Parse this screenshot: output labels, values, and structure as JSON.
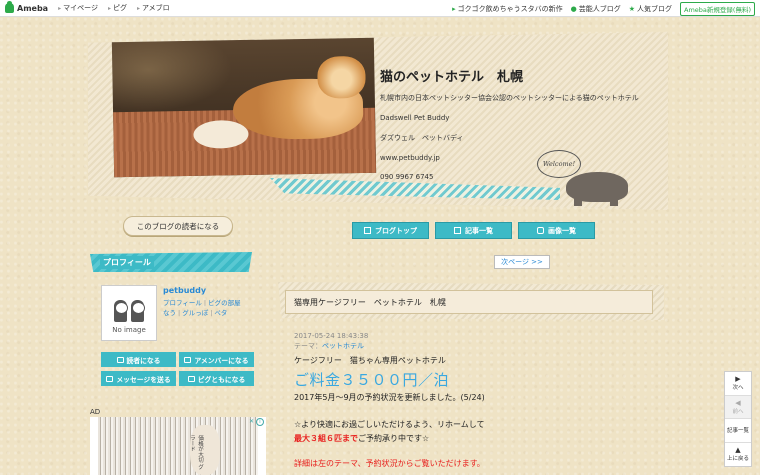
{
  "topbar": {
    "logo": "Ameba",
    "nav": [
      "マイページ",
      "ピグ",
      "アメブロ"
    ],
    "promo": "ゴクゴク飲めちゃうスタバの新作",
    "links": [
      "芸能人ブログ",
      "人気ブログ"
    ],
    "register": "Ameba新規登録(無料)",
    "accent": "#2daa4a"
  },
  "header": {
    "title": "猫のペットホテル　札幌",
    "lines": [
      "札幌市内の日本ペットシッター協会公認のペットシッターによる猫のペットホテル",
      "Dadswell Pet Buddy",
      "ダズウェル　ペットバディ",
      "www.petbuddy.jp",
      "090 9967 6745"
    ],
    "welcome": "Welcome!"
  },
  "reader_button": "このブログの読者になる",
  "nav_buttons": [
    "ブログトップ",
    "記事一覧",
    "画像一覧"
  ],
  "next_page": "次ページ >>",
  "profile": {
    "heading": "プロフィール",
    "no_image": "No image",
    "name": "petbuddy",
    "links_line1": [
      "プロフィール",
      "ピグの部屋"
    ],
    "links_line2": [
      "なう",
      "グルっぽ",
      "ペタ"
    ],
    "buttons": [
      "読者になる",
      "アメンバーになる",
      "メッセージを送る",
      "ピグともになる"
    ]
  },
  "ad": {
    "label": "AD",
    "image_text": "価格が大切 グラード"
  },
  "article": {
    "title": "猫専用ケージフリー　ペットホテル　札幌",
    "date": "2017-05-24 18:43:38",
    "theme_label": "テーマ：",
    "theme": "ペットホテル",
    "line1": "ケージフリー　猫ちゃん専用ペットホテル",
    "price": "ご料金３５００円／泊",
    "line2": "2017年5月〜9月の予約状況を更新しました。(5/24)",
    "line3": "☆より快適にお過ごしいただけるよう、リホームして",
    "line4_red": "最大３組６匹まで",
    "line4_rest": "ご予約承り中です☆",
    "line5": "詳細は左のテーマ、予約状況からご覧いただけます。"
  },
  "tools": [
    {
      "arrow": "▶",
      "label": "次へ"
    },
    {
      "arrow": "◀",
      "label": "前へ"
    },
    {
      "arrow": "",
      "label": "記事一覧"
    },
    {
      "arrow": "▲",
      "label": "上に戻る"
    }
  ]
}
